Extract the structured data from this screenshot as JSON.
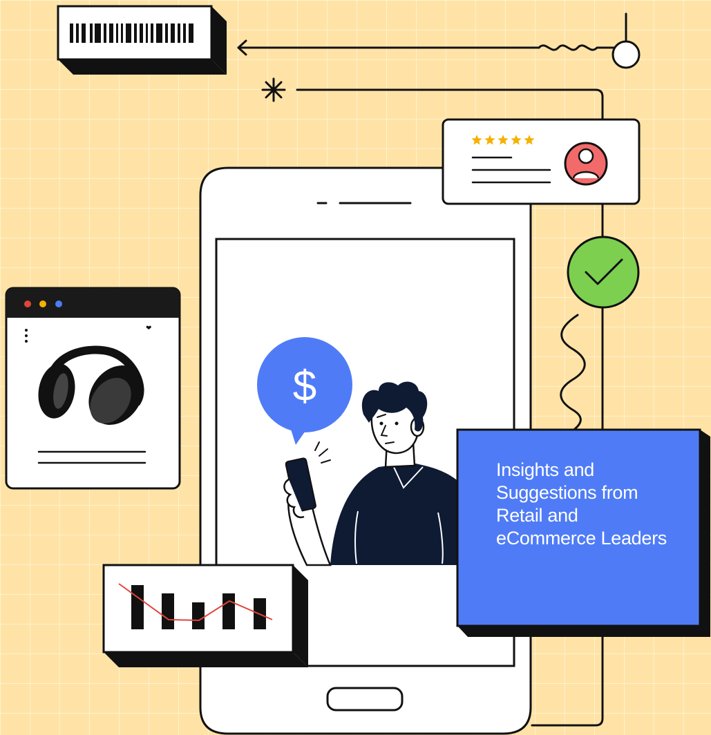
{
  "colors": {
    "background": "#ffe3a6",
    "ink": "#111111",
    "accent_blue": "#4f7cf6",
    "success_green": "#7ccf4f",
    "avatar_red": "#f26a6a",
    "star_gold": "#f5b100",
    "trend_red": "#e0453a"
  },
  "icons": {
    "barcode": "barcode-icon",
    "sparkle": "sparkle-icon",
    "toggle": "toggle-icon",
    "stars": "five-star-rating-icon",
    "avatar": "user-avatar-icon",
    "check": "check-icon",
    "dollar": "dollar-icon",
    "headphones": "headphones-icon",
    "wishlist": "heart-icon"
  },
  "review_card": {
    "rating_stars": 5
  },
  "dollar_bubble": {
    "symbol": "$"
  },
  "product_window": {
    "wishlist_mark": "❤"
  },
  "caption": {
    "text": "Insights and Suggestions from Retail and eCommerce Leaders"
  }
}
